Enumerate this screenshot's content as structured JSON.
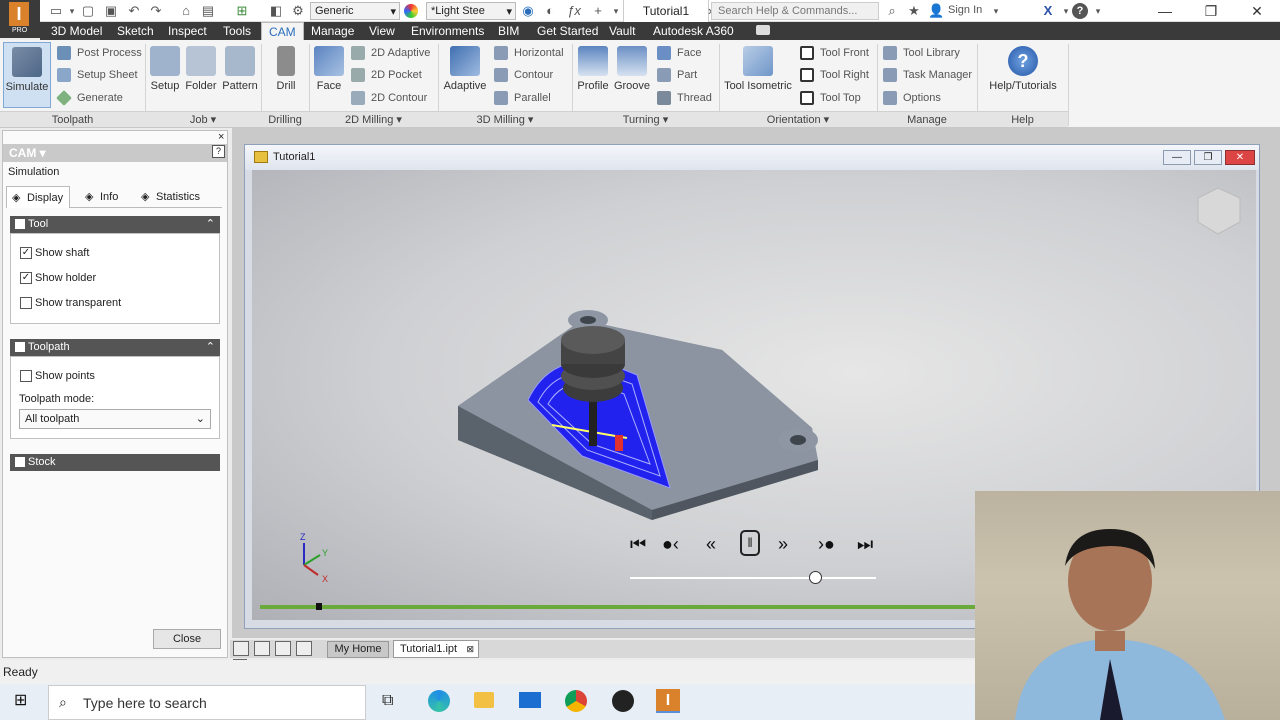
{
  "titlebar": {
    "material_dropdown": "Generic",
    "appearance_dropdown": "*Light Stee",
    "document_title": "Tutorial1",
    "search_placeholder": "Search Help & Commands...",
    "sign_in": "Sign In",
    "app_badge": "PRO"
  },
  "menu": {
    "tabs": [
      "3D Model",
      "Sketch",
      "Inspect",
      "Tools",
      "CAM",
      "Manage",
      "View",
      "Environments",
      "BIM",
      "Get Started",
      "Vault",
      "Autodesk A360"
    ],
    "active": "CAM"
  },
  "ribbon": {
    "toolpath": {
      "simulate": "Simulate",
      "post_process": "Post Process",
      "setup_sheet": "Setup Sheet",
      "generate": "Generate",
      "label": "Toolpath"
    },
    "job": {
      "setup": "Setup",
      "folder": "Folder",
      "pattern": "Pattern",
      "label": "Job"
    },
    "drilling": {
      "drill": "Drill",
      "label": "Drilling"
    },
    "milling2d": {
      "face": "Face",
      "adaptive": "2D Adaptive",
      "pocket": "2D Pocket",
      "contour": "2D Contour",
      "label": "2D Milling"
    },
    "milling3d": {
      "adaptive": "Adaptive",
      "horizontal": "Horizontal",
      "contour": "Contour",
      "parallel": "Parallel",
      "label": "3D Milling"
    },
    "turning": {
      "profile": "Profile",
      "groove": "Groove",
      "face": "Face",
      "part": "Part",
      "thread": "Thread",
      "label": "Turning"
    },
    "orientation": {
      "isometric": "Tool Isometric",
      "front": "Tool Front",
      "right": "Tool Right",
      "top": "Tool Top",
      "label": "Orientation"
    },
    "manage": {
      "library": "Tool Library",
      "task_manager": "Task Manager",
      "options": "Options",
      "label": "Manage"
    },
    "help": {
      "tutorials": "Help/Tutorials",
      "label": "Help"
    }
  },
  "browser": {
    "header": "CAM",
    "title": "Simulation",
    "tabs": [
      "Display",
      "Info",
      "Statistics"
    ],
    "tool_section": "Tool",
    "show_shaft": "Show shaft",
    "show_holder": "Show holder",
    "show_transparent": "Show transparent",
    "toolpath_section": "Toolpath",
    "show_points": "Show points",
    "toolpath_mode_label": "Toolpath mode:",
    "toolpath_mode_value": "All toolpath",
    "stock_section": "Stock",
    "close": "Close",
    "state": {
      "tool": true,
      "show_shaft": true,
      "show_holder": true,
      "show_transparent": false,
      "toolpath": true,
      "show_points": false,
      "stock": false
    }
  },
  "document": {
    "window_title": "Tutorial1",
    "tabs": [
      "My Home",
      "Tutorial1.ipt"
    ],
    "simulation_slider": 0.75,
    "progress": 0.06
  },
  "status": "Ready",
  "taskbar": {
    "search_placeholder": "Type here to search"
  },
  "colors": {
    "accent": "#2a6ebb",
    "toolpath": "#1a1aff",
    "app_orange": "#d9822b",
    "progress_green": "#6aaa3a"
  }
}
